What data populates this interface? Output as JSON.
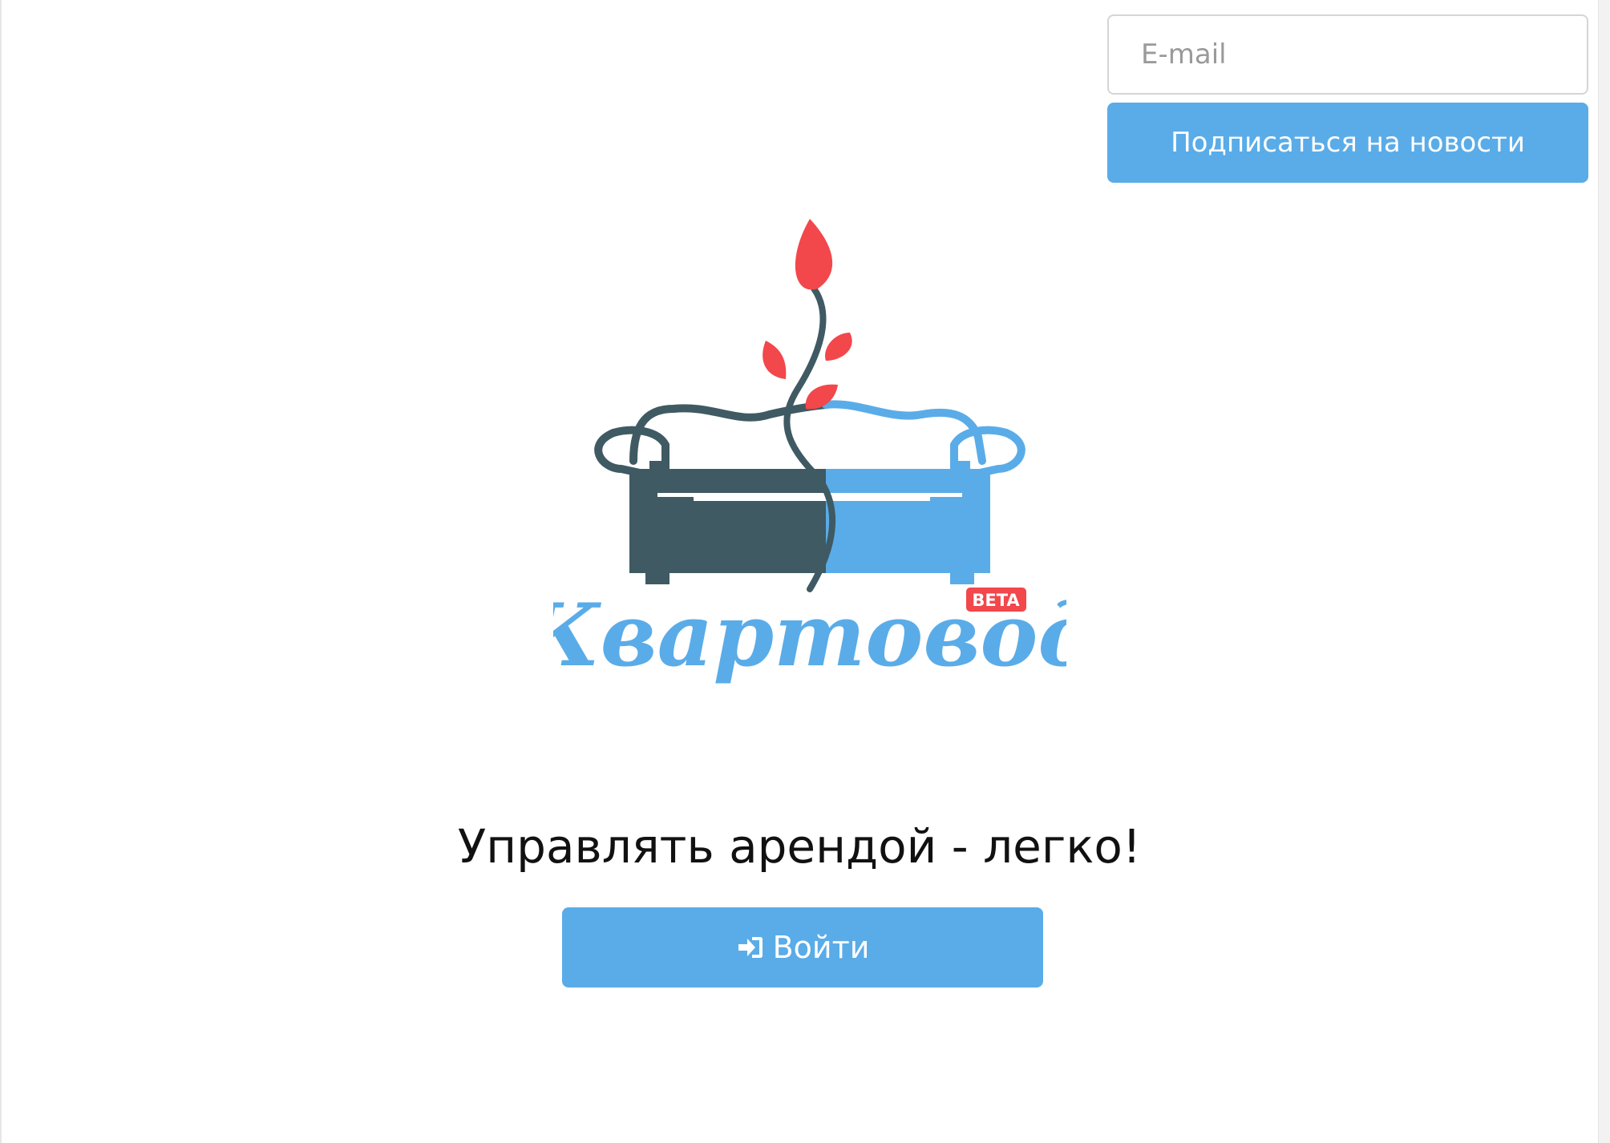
{
  "subscribe": {
    "email_placeholder": "E-mail",
    "button_label": "Подписаться на новости"
  },
  "logo": {
    "wordmark": "Квартовод",
    "badge": "BETA"
  },
  "hero": {
    "tagline": "Управлять арендой - легко!"
  },
  "login": {
    "button_label": "Войти",
    "icon": "sign-in-icon"
  },
  "colors": {
    "accent": "#5aace8",
    "sofa_dark": "#3f5a63",
    "sofa_light": "#5aace8",
    "leaf": "#f2474b",
    "badge": "#f2474b"
  }
}
